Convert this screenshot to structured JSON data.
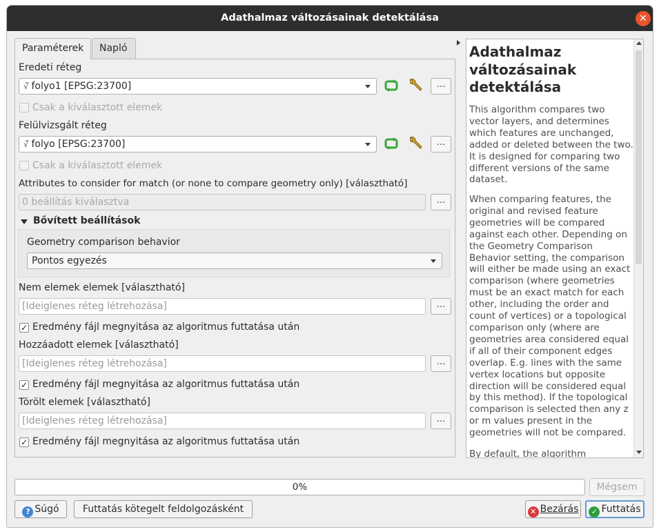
{
  "window": {
    "title": "Adathalmaz változásainak detektálása"
  },
  "tabs": [
    {
      "label": "Paraméterek",
      "active": true
    },
    {
      "label": "Napló",
      "active": false
    }
  ],
  "params": {
    "input_label": "Eredeti réteg",
    "input_value": "folyo1 [EPSG:23700]",
    "input_selected_only": "Csak a kiválasztott elemek",
    "revised_label": "Felülvizsgált réteg",
    "revised_value": "folyo [EPSG:23700]",
    "revised_selected_only": "Csak a kiválasztott elemek",
    "attributes_label": "Attributes to consider for match (or none to compare geometry only) [választható]",
    "attributes_placeholder": "0 beállítás kiválasztva",
    "advanced_label": "Bővített beállítások",
    "geometry_behavior_label": "Geometry comparison behavior",
    "geometry_behavior_value": "Pontos egyezés",
    "unchanged_label": "Nem elemek elemek [választható]",
    "unchanged_placeholder": "[Ideiglenes réteg létrehozása]",
    "unchanged_open": "Eredmény fájl megnyitása az algoritmus futtatása után",
    "added_label": "Hozzáadott elemek [választható]",
    "added_placeholder": "[Ideiglenes réteg létrehozása]",
    "added_open": "Eredmény fájl megnyitása az algoritmus futtatása után",
    "deleted_label": "Törölt elemek [választható]",
    "deleted_placeholder": "[Ideiglenes réteg létrehozása]",
    "deleted_open": "Eredmény fájl megnyitása az algoritmus futtatása után",
    "dots": "…"
  },
  "help": {
    "title": "Adathalmaz változásainak detektálása",
    "p1": "This algorithm compares two vector layers, and determines which features are unchanged, added or deleted between the two. It is designed for comparing two different versions of the same dataset.",
    "p2": "When comparing features, the original and revised feature geometries will be compared against each other. Depending on the Geometry Comparison Behavior setting, the comparison will either be made using an exact comparison (where geometries must be an exact match for each other, including the order and count of vertices) or a topological comparison only (where are geometries area considered equal if all of their component edges overlap. E.g. lines with the same vertex locations but opposite direction will be considered equal by this method). If the topological comparison is selected then any z or m values present in the geometries will not be compared.",
    "p3": "By default, the algorithm"
  },
  "progress": {
    "text": "0%",
    "value": 0
  },
  "buttons": {
    "cancel": "Mégsem",
    "help": "Súgó",
    "batch": "Futtatás kötegelt feldolgozásként",
    "close": "Bezárás",
    "run": "Futtatás"
  },
  "colors": {
    "titlebar": "#2e2e2e",
    "close_button": "#e9542e",
    "accent": "#5b9bd5",
    "run_icon": "#2e9e3c",
    "help_icon": "#3f84cf",
    "close_icon": "#d93a3a"
  }
}
